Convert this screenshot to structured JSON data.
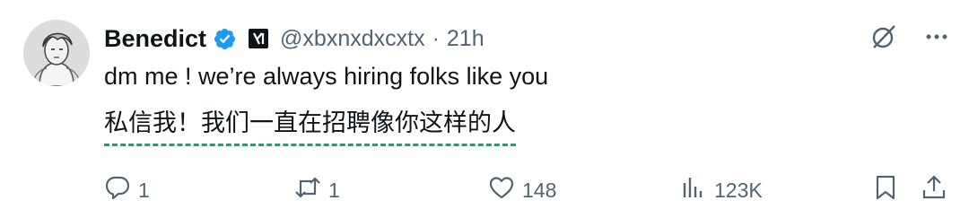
{
  "author": {
    "name": "Benedict",
    "handle": "@xbxnxdxcxtx",
    "separator": "·",
    "time": "21h"
  },
  "tweet": {
    "text_en": "dm me ! we’re always hiring folks like you",
    "text_zh": "私信我！我们一直在招聘像你这样的人"
  },
  "actions": {
    "replies": "1",
    "retweets": "1",
    "likes": "148",
    "views": "123K"
  },
  "colors": {
    "verified": "#1d9bf0",
    "muted": "#536471",
    "translation_underline": "#2e9a6c"
  },
  "icons": [
    "grok-icon",
    "more-icon",
    "reply-icon",
    "retweet-icon",
    "like-icon",
    "views-icon",
    "bookmark-icon",
    "share-icon",
    "verified-icon",
    "org-badge-icon"
  ]
}
